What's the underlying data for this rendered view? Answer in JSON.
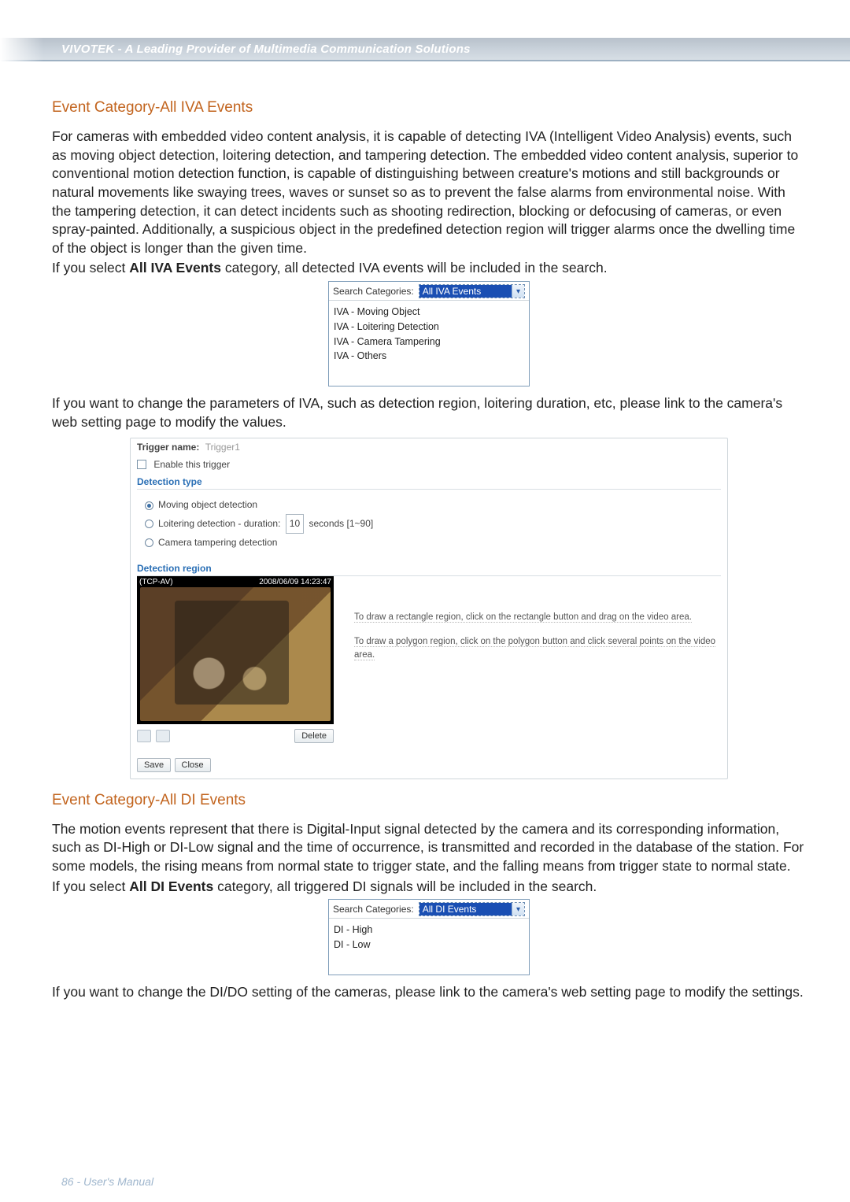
{
  "header": {
    "brand_tagline": "VIVOTEK - A Leading Provider of Multimedia Communication Solutions"
  },
  "section_iva": {
    "title": "Event Category-All IVA Events",
    "para1": "For cameras with embedded video content analysis, it is capable of detecting IVA (Intelligent Video Analysis) events, such as moving object detection, loitering detection, and tampering detection. The embedded video content analysis, superior to conventional motion detection function, is capable of distinguishing between creature's motions and still backgrounds or natural movements like swaying trees, waves or sunset so as to prevent the false alarms from environmental noise. With the tampering detection, it can detect incidents such as shooting redirection, blocking or defocusing of cameras, or even spray-painted. Additionally, a suspicious object in the predefined detection region will trigger alarms once the dwelling time of the object is longer than the given time.",
    "para2_prefix": "If you select ",
    "para2_bold": "All IVA Events",
    "para2_suffix": " category, all detected IVA events will be included in the search.",
    "select": {
      "label": "Search Categories:",
      "value": "All IVA Events",
      "options": [
        "IVA - Moving Object",
        "IVA - Loitering Detection",
        "IVA - Camera Tampering",
        "IVA - Others"
      ]
    },
    "para3": "If you want to change the parameters of IVA, such as detection region, loitering duration, etc, please link to the camera's web setting page to modify the values."
  },
  "trigger": {
    "name_label": "Trigger name:",
    "name_value": "Trigger1",
    "enable_label": "Enable this trigger",
    "detection_type_label": "Detection type",
    "opt_moving": "Moving object detection",
    "opt_loitering_prefix": "Loitering detection - duration:",
    "opt_loitering_value": "10",
    "opt_loitering_unit": "seconds [1~90]",
    "opt_tampering": "Camera tampering detection",
    "detection_region_label": "Detection region",
    "video_overlay_left": "(TCP-AV)",
    "video_overlay_right": "2008/06/09 14:23:47",
    "help1": "To draw a rectangle region, click on the rectangle button and drag on the video area.",
    "help2": "To draw a polygon region, click on the polygon button and click several points on the video area.",
    "delete_btn": "Delete",
    "save_btn": "Save",
    "close_btn": "Close"
  },
  "section_di": {
    "title": "Event Category-All DI Events",
    "para1": "The motion events represent that there is Digital-Input signal detected by the camera and its corresponding information, such as DI-High or DI-Low signal and the time of occurrence, is transmitted and recorded in the database of the station. For some models, the rising means from normal state to trigger state, and the falling means from trigger state to normal state.",
    "para2_prefix": "If you select ",
    "para2_bold": "All DI Events",
    "para2_suffix": " category, all triggered DI signals will be included in the search.",
    "select": {
      "label": "Search Categories:",
      "value": "All DI Events",
      "options": [
        "DI - High",
        "DI - Low"
      ]
    },
    "para3": "If you want to change the DI/DO setting of the cameras, please link to the camera's web setting page to modify the settings."
  },
  "footer": {
    "page_label": "86 - User's Manual"
  }
}
